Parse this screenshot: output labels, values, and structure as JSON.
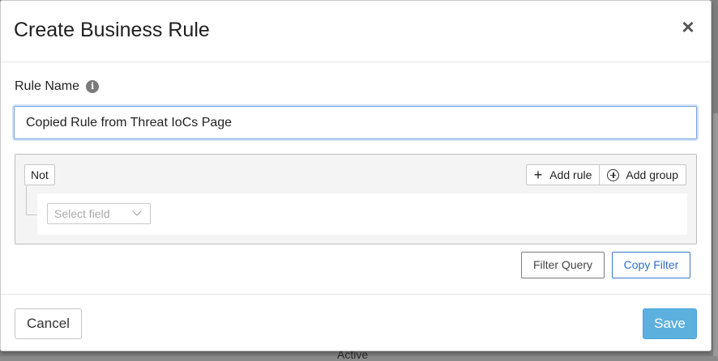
{
  "background": {
    "partial_text": "Active"
  },
  "dialog": {
    "title": "Create Business Rule",
    "close_symbol": "×",
    "rule_name_label": "Rule Name",
    "info_symbol": "i",
    "rule_name_value": "Copied Rule from Threat IoCs Page"
  },
  "query_builder": {
    "combinator_label": "Not",
    "add_rule_label": "Add rule",
    "add_group_label": "Add group",
    "plus_symbol": "+",
    "field_select_placeholder": "Select field"
  },
  "actions": {
    "filter_query_label": "Filter Query",
    "copy_filter_label": "Copy Filter"
  },
  "footer": {
    "cancel_label": "Cancel",
    "save_label": "Save"
  },
  "colors": {
    "primary": "#5bb0de",
    "link": "#2f6fc4",
    "input_focus": "#7aa7e2"
  }
}
